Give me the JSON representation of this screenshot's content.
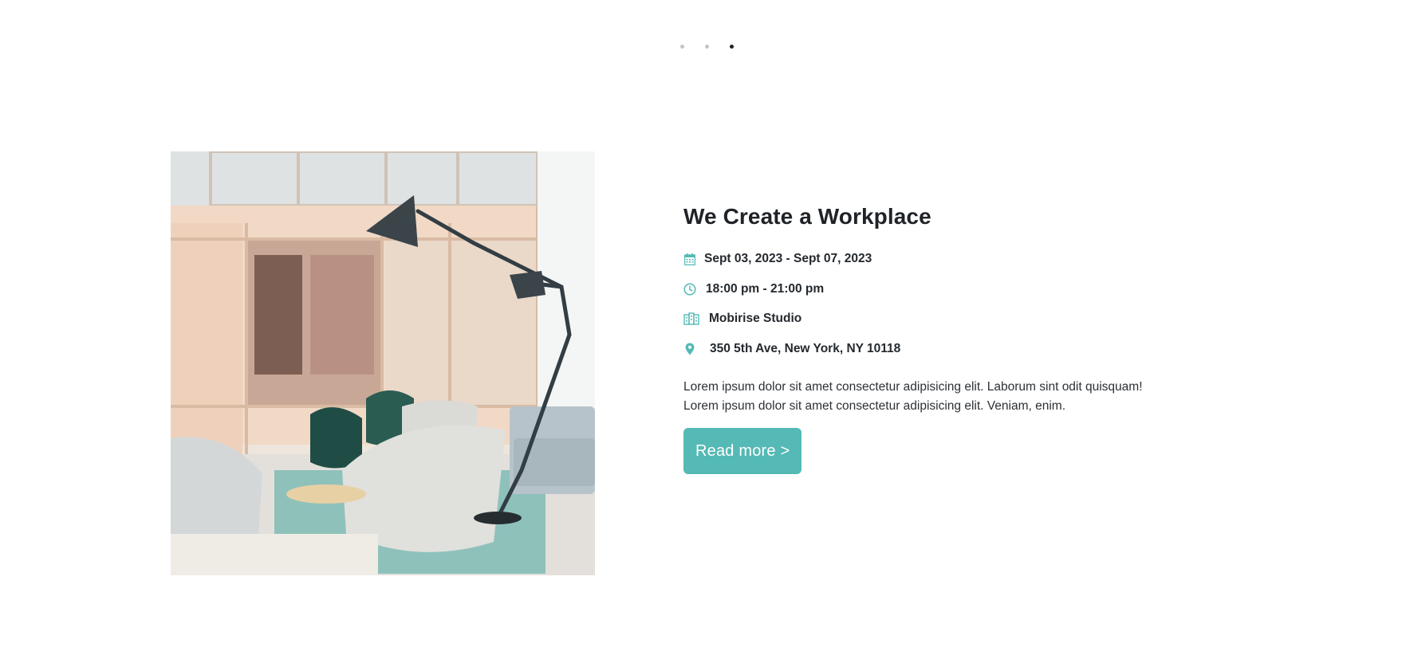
{
  "carousel": {
    "dots": [
      {
        "label": "slide-1",
        "active": false
      },
      {
        "label": "slide-2",
        "active": false
      },
      {
        "label": "slide-3",
        "active": true
      }
    ]
  },
  "event": {
    "title": "We Create a Workplace",
    "date": "Sept 03, 2023 - Sept 07, 2023",
    "time": "18:00 pm - 21:00 pm",
    "venue": "Mobirise Studio",
    "address": "350 5th Ave, New York, NY 10118",
    "description_line1": "Lorem ipsum dolor sit amet consectetur adipisicing elit. Laborum sint odit quisquam!",
    "description_line2": "Lorem ipsum dolor sit amet consectetur adipisicing elit. Veniam, enim.",
    "button_label": "Read more >"
  },
  "icons": {
    "date": "calendar-icon",
    "time": "clock-icon",
    "venue": "building-icon",
    "address": "map-pin-icon"
  },
  "colors": {
    "accent": "#55b9b5",
    "dot_inactive": "#c4c4c4",
    "dot_active": "#222222",
    "text": "#212529"
  }
}
